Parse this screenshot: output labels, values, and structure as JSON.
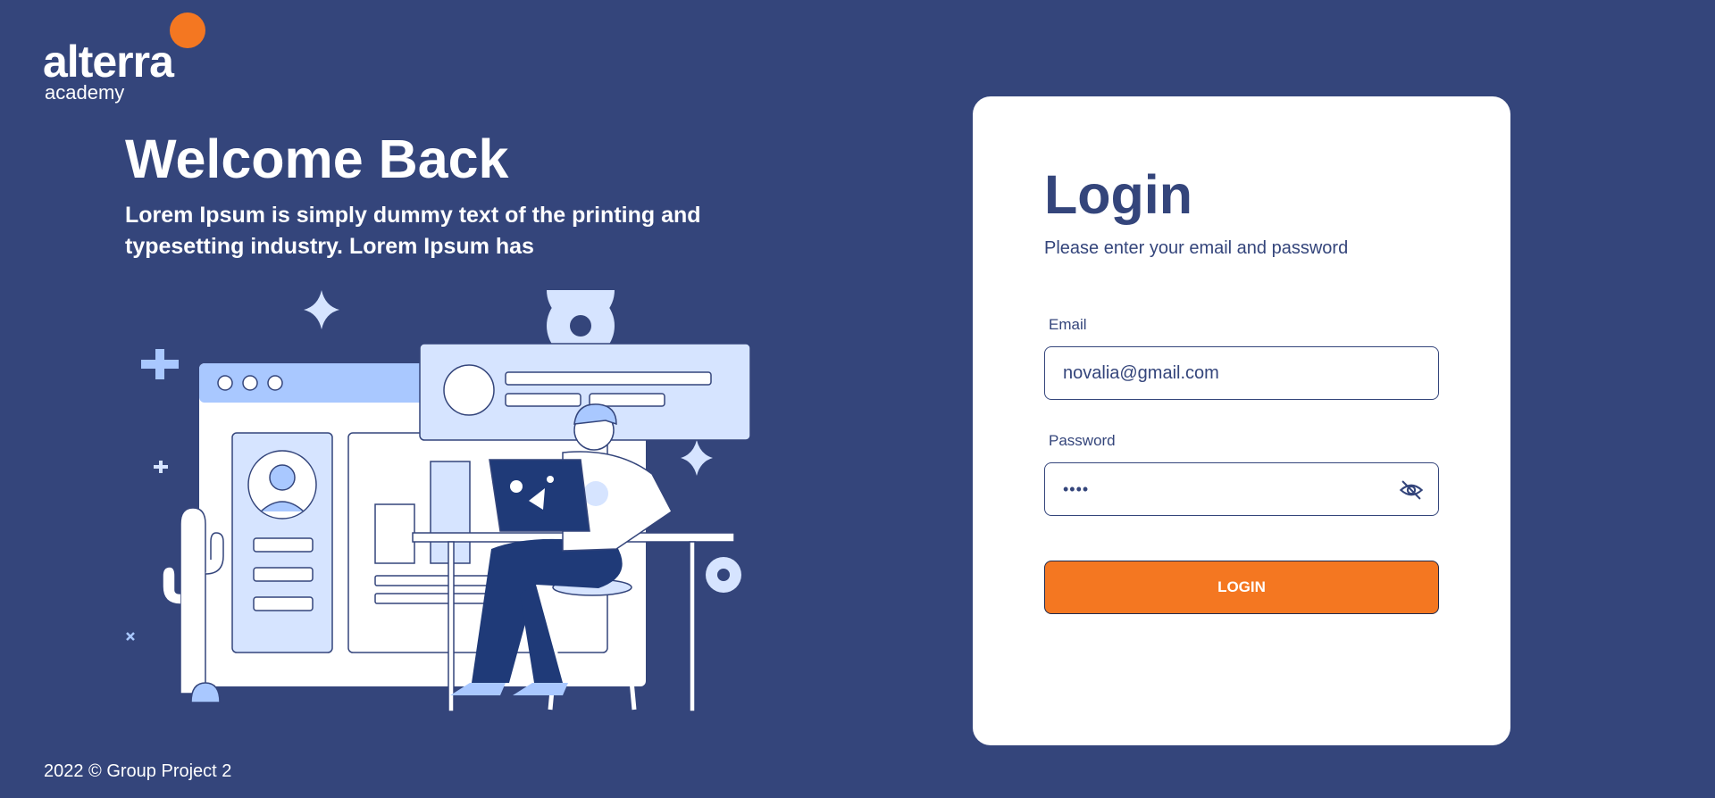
{
  "brand": {
    "wordmark": "alterra",
    "subtext": "academy",
    "accent_color": "#f47721"
  },
  "hero": {
    "title": "Welcome Back",
    "subtitle": "Lorem Ipsum is simply dummy text of the printing and typesetting industry. Lorem Ipsum has"
  },
  "login": {
    "title": "Login",
    "subtitle": "Please enter your email and password",
    "email_label": "Email",
    "email_value": "novalia@gmail.com",
    "password_label": "Password",
    "password_masked": "••••",
    "password_toggle_icon": "eye-off-icon",
    "submit_label": "LOGIN"
  },
  "footer": {
    "text": "2022 © Group Project 2"
  },
  "colors": {
    "background": "#34457b",
    "card": "#ffffff",
    "primary_text": "#34457b",
    "button": "#f47721",
    "illustration_light": "#d6e4ff",
    "illustration_mid": "#a9c8ff"
  }
}
